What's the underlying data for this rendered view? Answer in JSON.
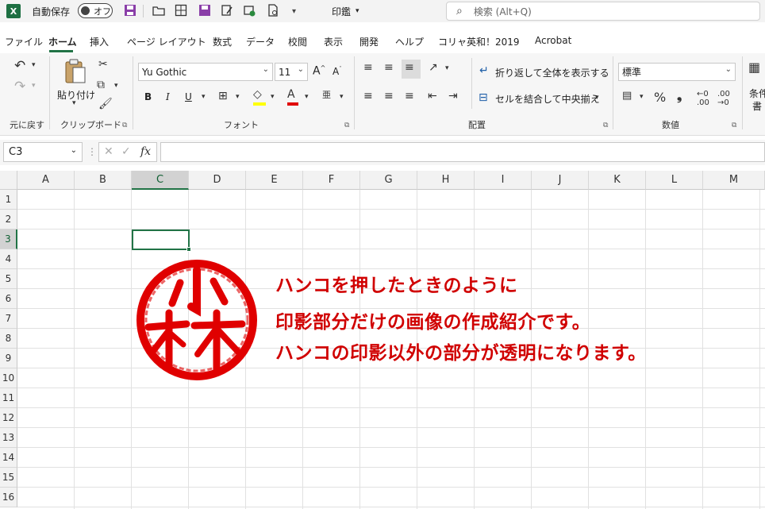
{
  "titlebar": {
    "app_icon": "X",
    "autosave_label": "自動保存",
    "autosave_state": "オフ",
    "doc_title": "印鑑",
    "search_placeholder": "検索 (Alt+Q)"
  },
  "tabs": [
    "ファイル",
    "ホーム",
    "挿入",
    "ページ レイアウト",
    "数式",
    "データ",
    "校閲",
    "表示",
    "開発",
    "ヘルプ",
    "コリャ英和！2019",
    "Acrobat"
  ],
  "active_tab": "ホーム",
  "ribbon": {
    "groups": {
      "undo": "元に戻す",
      "clipboard": "クリップボード",
      "font": "フォント",
      "alignment": "配置",
      "number": "数値"
    },
    "paste_label": "貼り付け",
    "font_name": "Yu Gothic",
    "font_size": "11",
    "wrap_text": "折り返して全体を表示する",
    "merge_center": "セルを結合して中央揃え",
    "number_format": "標準",
    "cond_format_1": "条件",
    "cond_format_2": "書"
  },
  "formula_bar": {
    "name_box": "C3",
    "fx": "fx",
    "formula": ""
  },
  "columns": [
    "A",
    "B",
    "C",
    "D",
    "E",
    "F",
    "G",
    "H",
    "I",
    "J",
    "K",
    "L",
    "M"
  ],
  "rows": [
    "1",
    "2",
    "3",
    "4",
    "5",
    "6",
    "7",
    "8",
    "9",
    "10",
    "11",
    "12",
    "13",
    "14",
    "15",
    "16"
  ],
  "selected_cell": {
    "column": "C",
    "row": "3"
  },
  "stamp": {
    "text": "小林",
    "color": "#e00000"
  },
  "message": [
    "ハンコを押したときのように",
    "印影部分だけの画像の作成紹介です。",
    "ハンコの印影以外の部分が透明になります。"
  ],
  "colors": {
    "accent": "#217346",
    "message": "#d00000"
  }
}
